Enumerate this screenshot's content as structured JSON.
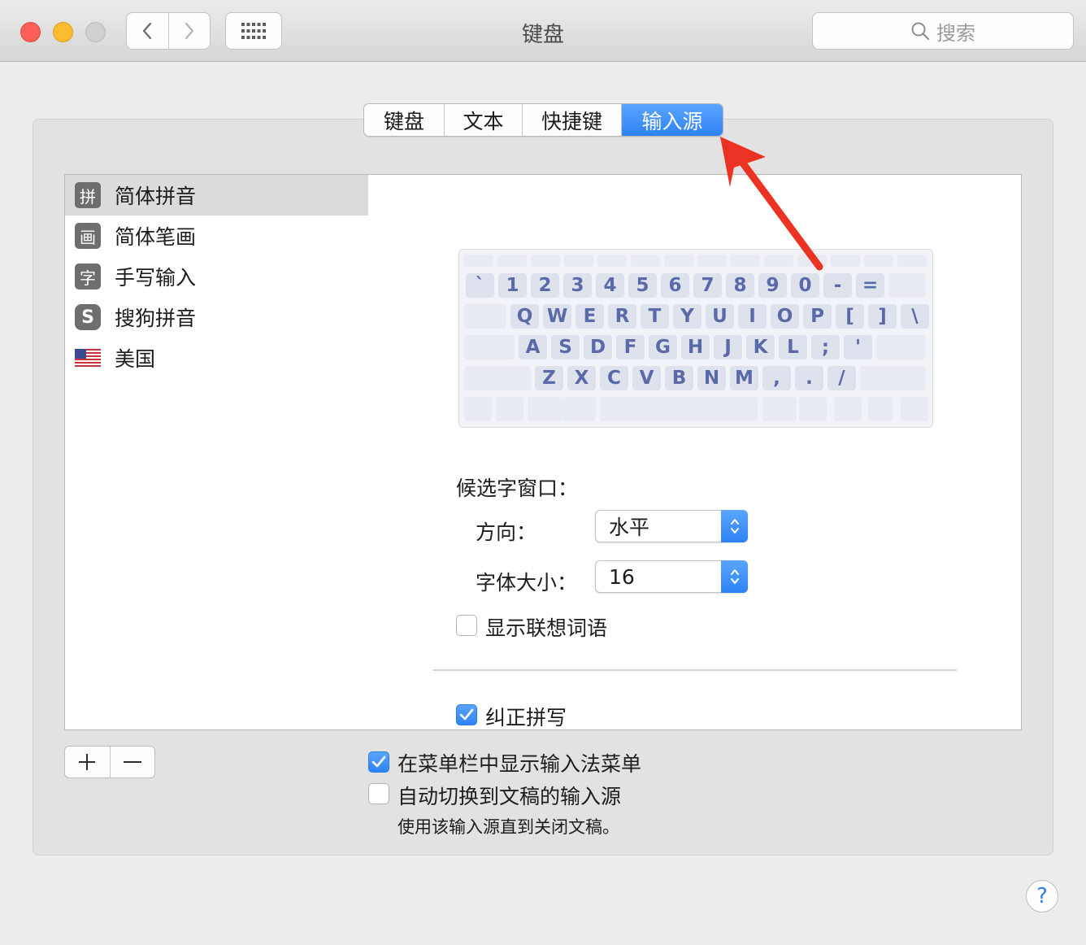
{
  "window": {
    "title": "键盘"
  },
  "search": {
    "placeholder": "搜索"
  },
  "tabs": [
    {
      "label": "键盘",
      "active": false
    },
    {
      "label": "文本",
      "active": false
    },
    {
      "label": "快捷键",
      "active": false
    },
    {
      "label": "输入源",
      "active": true
    }
  ],
  "input_sources": [
    {
      "icon": "pinyin-icon",
      "icon_char": "拼",
      "label": "简体拼音",
      "selected": true
    },
    {
      "icon": "stroke-icon",
      "icon_char": "画",
      "label": "简体笔画",
      "selected": false
    },
    {
      "icon": "handwriting-icon",
      "icon_char": "字",
      "label": "手写输入",
      "selected": false
    },
    {
      "icon": "sogou-icon",
      "icon_char": "S",
      "label": "搜狗拼音",
      "selected": false
    },
    {
      "icon": "us-flag-icon",
      "icon_char": "",
      "label": "美国",
      "selected": false
    }
  ],
  "keyboard": {
    "row1": [
      "`",
      "1",
      "2",
      "3",
      "4",
      "5",
      "6",
      "7",
      "8",
      "9",
      "0",
      "-",
      "="
    ],
    "row2": [
      "Q",
      "W",
      "E",
      "R",
      "T",
      "Y",
      "U",
      "I",
      "O",
      "P",
      "[",
      "]",
      "\\"
    ],
    "row3": [
      "A",
      "S",
      "D",
      "F",
      "G",
      "H",
      "J",
      "K",
      "L",
      ";",
      "'"
    ],
    "row4": [
      "Z",
      "X",
      "C",
      "V",
      "B",
      "N",
      "M",
      ",",
      ".",
      "/"
    ]
  },
  "candidate": {
    "heading": "候选字窗口：",
    "orientation_label": "方向：",
    "orientation_value": "水平",
    "font_size_label": "字体大小：",
    "font_size_value": "16"
  },
  "options": {
    "show_predictions": {
      "label": "显示联想词语",
      "checked": false
    },
    "correct_spelling": {
      "label": "纠正拼写",
      "checked": true
    }
  },
  "bottom": {
    "add_label": "+",
    "remove_label": "−",
    "show_menu": {
      "label": "在菜单栏中显示输入法菜单",
      "checked": true
    },
    "auto_switch": {
      "label": "自动切换到文稿的输入源",
      "checked": false
    },
    "auto_switch_note": "使用该输入源直到关闭文稿。"
  },
  "help_label": "?",
  "colors": {
    "accent": "#2e82f5",
    "annotation_arrow": "#ea3323"
  }
}
